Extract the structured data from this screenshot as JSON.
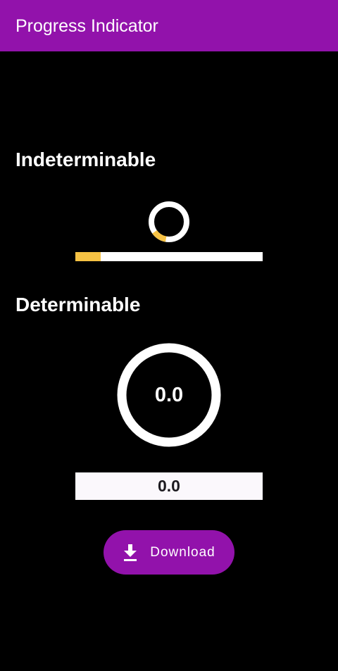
{
  "app_bar": {
    "title": "Progress Indicator",
    "color": "#9212ab"
  },
  "indeterminable": {
    "title": "Indeterminable",
    "accent_color": "#f6c244"
  },
  "determinable": {
    "title": "Determinable",
    "value": 0.0,
    "circular_label": "0.0",
    "linear_label": "0.0"
  },
  "download_button": {
    "label": "Download",
    "icon": "download-icon"
  }
}
